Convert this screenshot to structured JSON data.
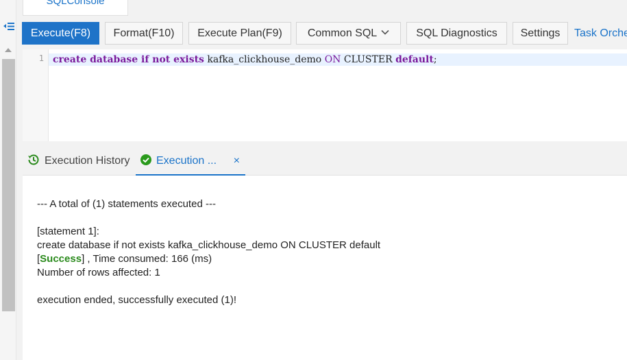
{
  "top_tab": {
    "label": "SQLConsole"
  },
  "toolbar": {
    "execute": "Execute(F8)",
    "format": "Format(F10)",
    "execute_plan": "Execute Plan(F9)",
    "common_sql": "Common SQL",
    "sql_diagnostics": "SQL Diagnostics",
    "settings": "Settings",
    "task_orchestration": "Task Orche"
  },
  "editor": {
    "line_number": "1",
    "tokens": {
      "t1": "create database if not exists",
      "t2": " kafka_clickhouse_demo ",
      "t3": "ON",
      "t4": " CLUSTER ",
      "t5": "default",
      "t6": ";"
    }
  },
  "result_tabs": {
    "history": "Execution History",
    "execution": "Execution ...",
    "close": "×"
  },
  "output": {
    "summary": "--- A total of (1) statements executed ---",
    "statement_header": "[statement 1]:",
    "statement_sql": "create database if not exists kafka_clickhouse_demo ON CLUSTER default",
    "bracket_open": "[",
    "status": "Success",
    "time_text": "] , Time consumed: 166 (ms)",
    "rows_affected": "Number of rows affected: 1",
    "ended": "execution ended, successfully executed (1)!"
  },
  "colors": {
    "primary": "#1e73c8",
    "link": "#1a73c9",
    "success": "#2a8a1c",
    "keyword": "#7a1a9c"
  },
  "icons": {
    "collapse": "indent-collapse-icon",
    "history": "history-icon",
    "success": "check-circle-icon",
    "dropdown": "chevron-down-icon"
  }
}
